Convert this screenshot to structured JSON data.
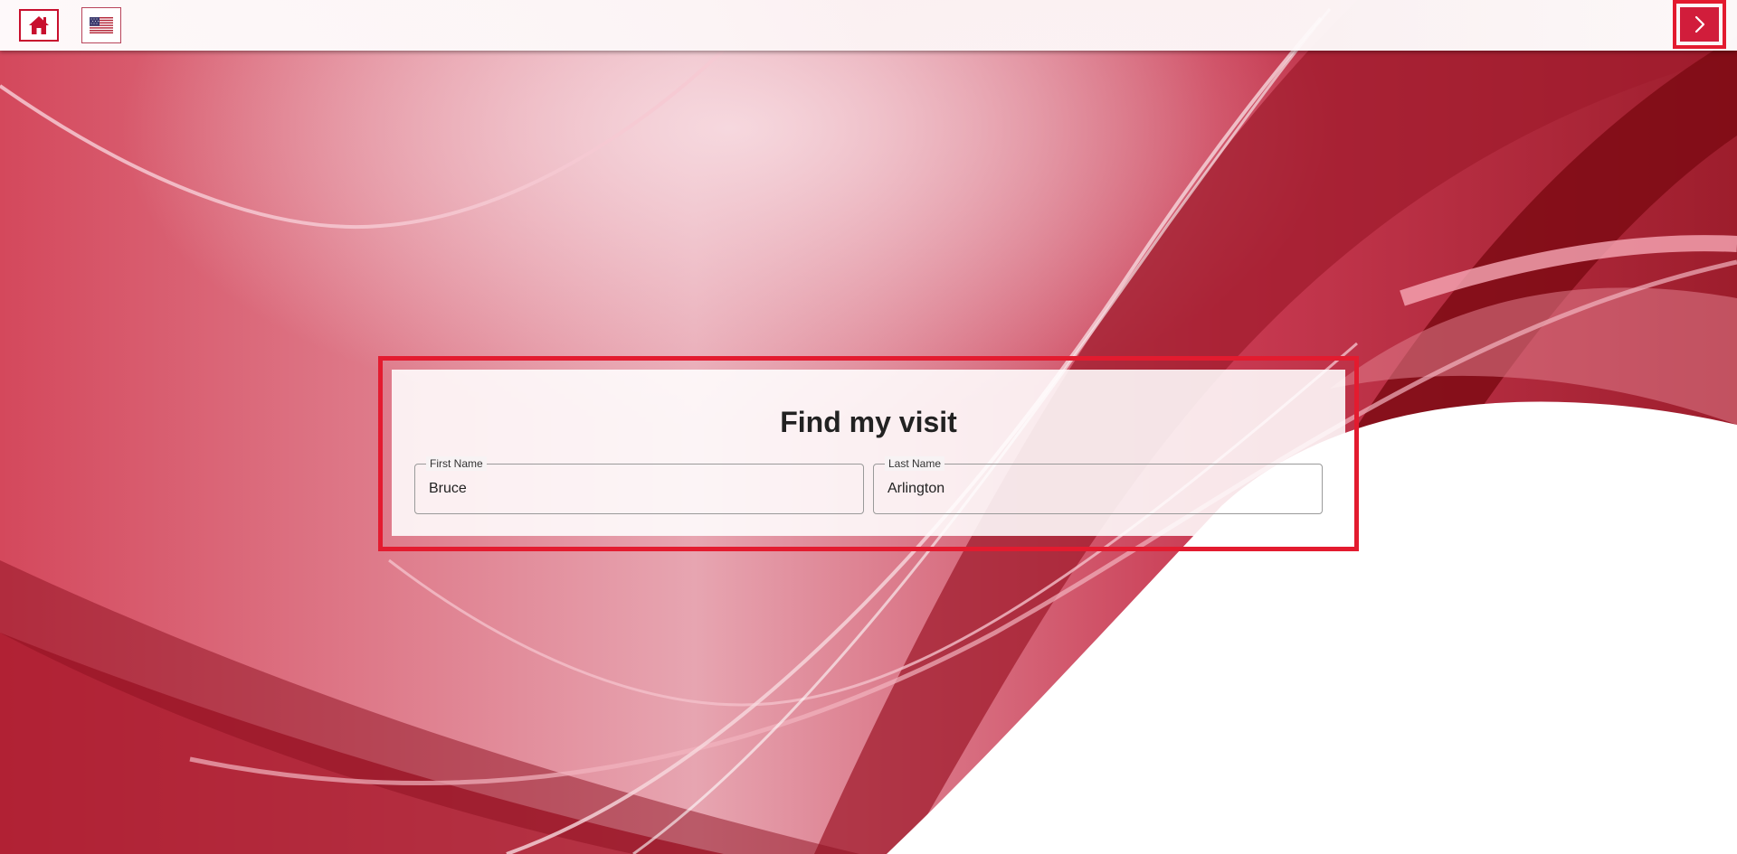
{
  "header": {
    "home_icon": "home-icon",
    "language_icon": "us-flag-icon",
    "next_icon": "chevron-right-icon"
  },
  "main": {
    "title": "Find my visit",
    "fields": [
      {
        "label": "First Name",
        "value": "Bruce"
      },
      {
        "label": "Last Name",
        "value": "Arlington"
      }
    ]
  },
  "colors": {
    "accent": "#d11d3b",
    "highlight": "#e31b2f",
    "background_red": "#c8283f"
  }
}
